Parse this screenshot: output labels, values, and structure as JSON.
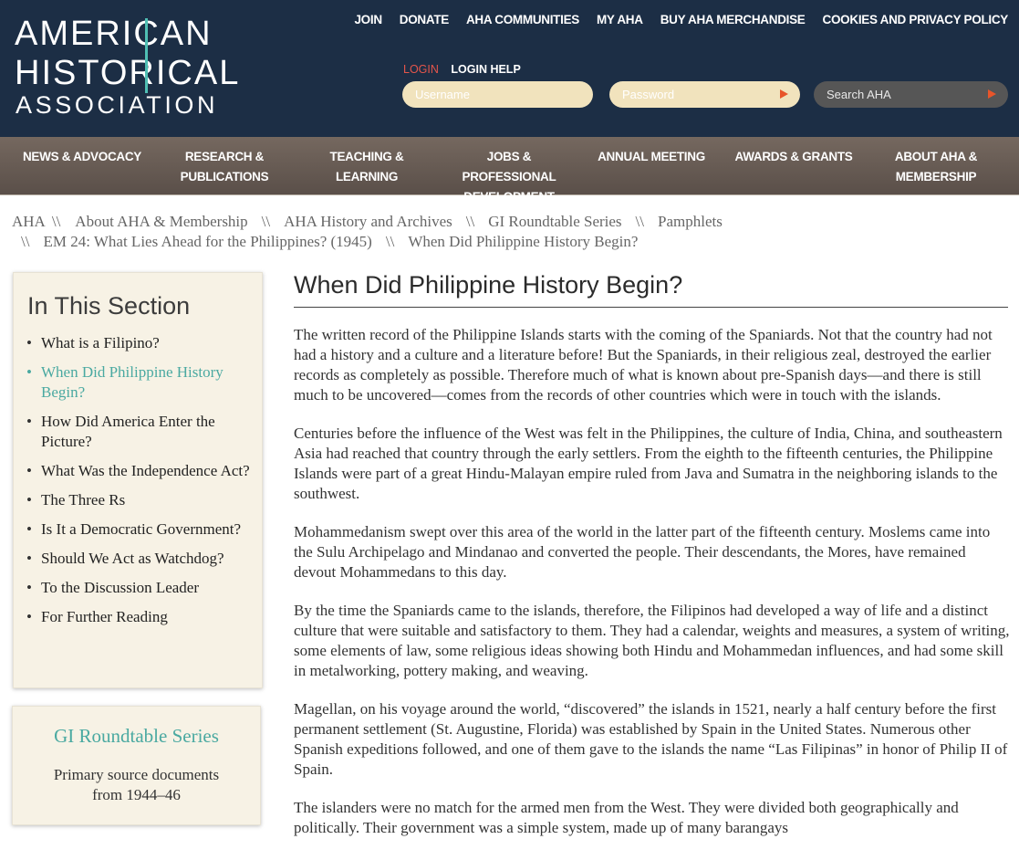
{
  "logo": {
    "line1": "AMERICAN",
    "line2": "HISTORICAL",
    "line3": "ASSOCIATION"
  },
  "top_nav": [
    "JOIN",
    "DONATE",
    "AHA COMMUNITIES",
    "MY AHA",
    "BUY AHA MERCHANDISE",
    "COOKIES AND PRIVACY POLICY"
  ],
  "login": {
    "login_label": "LOGIN",
    "help_label": "LOGIN HELP",
    "username_placeholder": "Username",
    "password_placeholder": "Password"
  },
  "search": {
    "placeholder": "Search AHA"
  },
  "main_nav": [
    "NEWS & ADVOCACY",
    "RESEARCH & PUBLICATIONS",
    "TEACHING & LEARNING",
    "JOBS & PROFESSIONAL DEVELOPMENT",
    "ANNUAL MEETING",
    "AWARDS & GRANTS",
    "ABOUT AHA & MEMBERSHIP"
  ],
  "breadcrumb": {
    "separator": "\\\\",
    "items": [
      "AHA",
      "About AHA & Membership",
      "AHA History and Archives",
      "GI Roundtable Series",
      "Pamphlets",
      "EM 24: What Lies Ahead for the Philippines? (1945)",
      "When Did Philippine History Begin?"
    ]
  },
  "sidebar": {
    "section_title": "In This Section",
    "items": [
      "What is a Filipino?",
      "When Did Philippine History Begin?",
      "How Did America Enter the Picture?",
      "What Was the Independence Act?",
      "The Three Rs",
      "Is It a Democratic Government?",
      "Should We Act as Watchdog?",
      "To the Discussion Leader",
      "For Further Reading"
    ],
    "series_title": "GI Roundtable Series",
    "series_text": "Primary source documents from 1944–46"
  },
  "article": {
    "title": "When Did Philippine History Begin?",
    "paragraphs": [
      "The written record of the Philippine Islands starts with the coming of the Spaniards. Not that the country had not had a history and a culture and a literature before! But the Spaniards, in their religious zeal, destroyed the earlier records as completely as possible. Therefore much of what is known about pre-Spanish days—and there is still much to be uncovered—comes from the records of other countries which were in touch with the islands.",
      "Centuries before the influence of the West was felt in the Philippines, the culture of India, China, and southeastern Asia had reached that country through the early settlers. From the eighth to the fifteenth centuries, the Philippine Islands were part of a great Hindu-Malayan empire ruled from Java and Sumatra in the neighboring islands to the southwest.",
      "Mohammedanism swept over this area of the world in the latter part of the fifteenth century. Moslems came into the Sulu Archipelago and Mindanao and converted the people. Their descendants, the Mores, have remained devout Mohammedans to this day.",
      "By the time the Spaniards came to the islands, therefore, the Filipinos had developed a way of life and a distinct culture that were suitable and satisfactory to them. They had a calendar, weights and measures, a system of writing, some elements of law, some religious ideas showing both Hindu and Mohammedan influences, and had some skill in metalworking, pottery making, and weaving.",
      "Magellan, on his voyage around the world, “discovered” the islands in 1521, nearly a half century before the first permanent settlement (St. Augustine, Florida) was established by Spain in the United States. Numerous other Spanish expeditions followed, and one of them gave to the islands the name “Las Filipinas” in honor of Philip II of Spain.",
      "The islanders were no match for the armed men from the West. They were divided both geographically and politically. Their government was a simple system, made up of many barangays"
    ]
  },
  "colors": {
    "header_bg": "#1c2e45",
    "nav_bg": "#6a5d58",
    "accent_teal": "#4aa9a1",
    "login_red": "#e4554b",
    "sidebar_bg": "#f7f2e5",
    "field_bg": "#f1e3bd",
    "arrow_orange": "#e8552a"
  }
}
